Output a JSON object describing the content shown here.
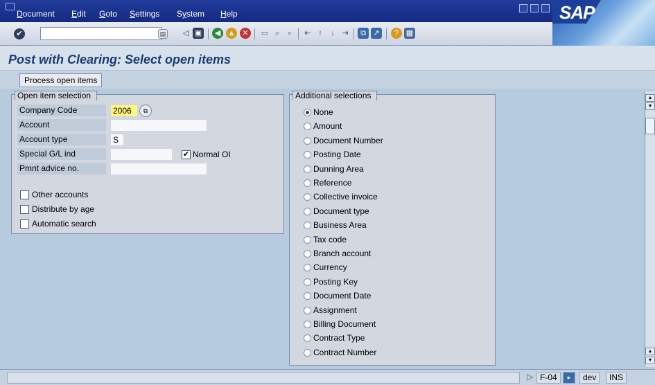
{
  "menu": {
    "items": [
      {
        "label": "Document",
        "u": "D"
      },
      {
        "label": "Edit",
        "u": "E"
      },
      {
        "label": "Goto",
        "u": "G"
      },
      {
        "label": "Settings",
        "u": "S"
      },
      {
        "label": "System",
        "u": "y"
      },
      {
        "label": "Help",
        "u": "H"
      }
    ],
    "logo": "SAP"
  },
  "toolbar": {
    "command_value": "",
    "icons": [
      "enter-icon",
      "back-icon",
      "exit-icon",
      "cancel-icon",
      "print-icon",
      "find-icon",
      "find-next-icon",
      "first-page-icon",
      "prev-page-icon",
      "next-page-icon",
      "last-page-icon",
      "new-session-icon",
      "shortcut-icon",
      "help-icon",
      "layout-icon"
    ]
  },
  "title": "Post with Clearing: Select open items",
  "app_toolbar": {
    "process_button": "Process open items"
  },
  "open_item_selection": {
    "legend": "Open item selection",
    "company_code_label": "Company Code",
    "company_code_value": "2006",
    "account_label": "Account",
    "account_value": "",
    "account_type_label": "Account type",
    "account_type_value": "S",
    "special_gl_label": "Special G/L ind",
    "special_gl_value": "",
    "normal_oi_label": "Normal OI",
    "normal_oi_checked": true,
    "pmnt_advice_label": "Pmnt advice no.",
    "pmnt_advice_value": "",
    "checkboxes": [
      {
        "label": "Other accounts",
        "checked": false
      },
      {
        "label": "Distribute by age",
        "checked": false
      },
      {
        "label": "Automatic search",
        "checked": false
      }
    ]
  },
  "additional_selections": {
    "legend": "Additional selections",
    "selected": "None",
    "options": [
      "None",
      "Amount",
      "Document Number",
      "Posting Date",
      "Dunning Area",
      "Reference",
      "Collective invoice",
      "Document type",
      "Business Area",
      "Tax code",
      "Branch account",
      "Currency",
      "Posting Key",
      "Document Date",
      "Assignment",
      "Billing Document",
      "Contract Type",
      "Contract Number"
    ]
  },
  "statusbar": {
    "message": "",
    "transaction": "F-04",
    "system": "dev",
    "mode": "INS"
  }
}
